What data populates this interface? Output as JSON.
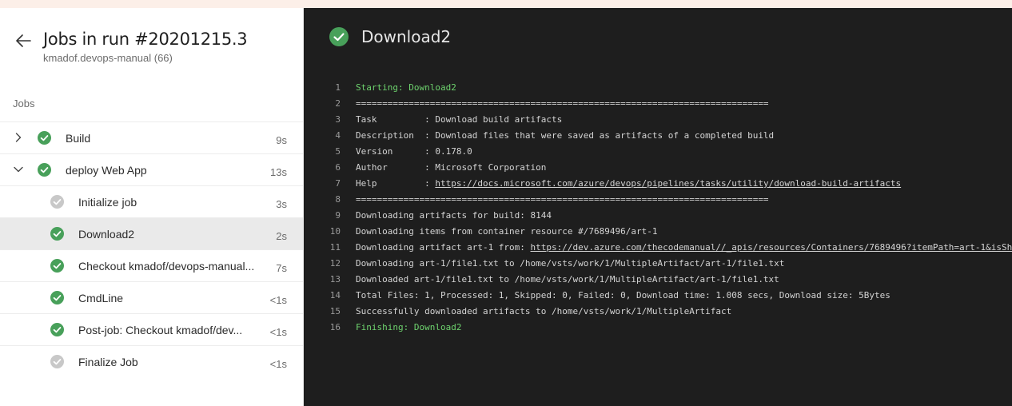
{
  "sidebar": {
    "title": "Jobs in run #20201215.3",
    "subtitle": "kmadof.devops-manual (66)",
    "jobs_label": "Jobs",
    "items": [
      {
        "label": "Build",
        "duration": "9s",
        "status": "success",
        "expand": "collapsed",
        "indent": 0
      },
      {
        "label": "deploy Web App",
        "duration": "13s",
        "status": "success",
        "expand": "expanded",
        "indent": 0
      },
      {
        "label": "Initialize job",
        "duration": "3s",
        "status": "skipped",
        "indent": 1
      },
      {
        "label": "Download2",
        "duration": "2s",
        "status": "success",
        "indent": 1,
        "selected": true
      },
      {
        "label": "Checkout kmadof/devops-manual...",
        "duration": "7s",
        "status": "success",
        "indent": 1
      },
      {
        "label": "CmdLine",
        "duration": "<1s",
        "status": "success",
        "indent": 1
      },
      {
        "label": "Post-job: Checkout kmadof/dev...",
        "duration": "<1s",
        "status": "success",
        "indent": 1
      },
      {
        "label": "Finalize Job",
        "duration": "<1s",
        "status": "skipped",
        "indent": 1
      }
    ]
  },
  "main": {
    "task_title": "Download2",
    "task_status": "success",
    "log": [
      {
        "n": "1",
        "text": "Starting: Download2",
        "color": "green"
      },
      {
        "n": "2",
        "text": "=============================================================================="
      },
      {
        "n": "3",
        "text": "Task         : Download build artifacts"
      },
      {
        "n": "4",
        "text": "Description  : Download files that were saved as artifacts of a completed build"
      },
      {
        "n": "5",
        "text": "Version      : 0.178.0"
      },
      {
        "n": "6",
        "text": "Author       : Microsoft Corporation"
      },
      {
        "n": "7",
        "text": "Help         : ",
        "link": "https://docs.microsoft.com/azure/devops/pipelines/tasks/utility/download-build-artifacts"
      },
      {
        "n": "8",
        "text": "=============================================================================="
      },
      {
        "n": "9",
        "text": "Downloading artifacts for build: 8144"
      },
      {
        "n": "10",
        "text": "Downloading items from container resource #/7689496/art-1"
      },
      {
        "n": "11",
        "text": "Downloading artifact art-1 from: ",
        "link": "https://dev.azure.com/thecodemanual//_apis/resources/Containers/7689496?itemPath=art-1&isSha"
      },
      {
        "n": "12",
        "text": "Downloading art-1/file1.txt to /home/vsts/work/1/MultipleArtifact/art-1/file1.txt"
      },
      {
        "n": "13",
        "text": "Downloaded art-1/file1.txt to /home/vsts/work/1/MultipleArtifact/art-1/file1.txt"
      },
      {
        "n": "14",
        "text": "Total Files: 1, Processed: 1, Skipped: 0, Failed: 0, Download time: 1.008 secs, Download size: 5Bytes"
      },
      {
        "n": "15",
        "text": "Successfully downloaded artifacts to /home/vsts/work/1/MultipleArtifact"
      },
      {
        "n": "16",
        "text": "Finishing: Download2",
        "color": "green"
      }
    ]
  },
  "colors": {
    "success": "#48a05a",
    "skipped": "#c8c8c8",
    "log_green": "#6ed36e",
    "log_bg": "#1e1e1e"
  }
}
